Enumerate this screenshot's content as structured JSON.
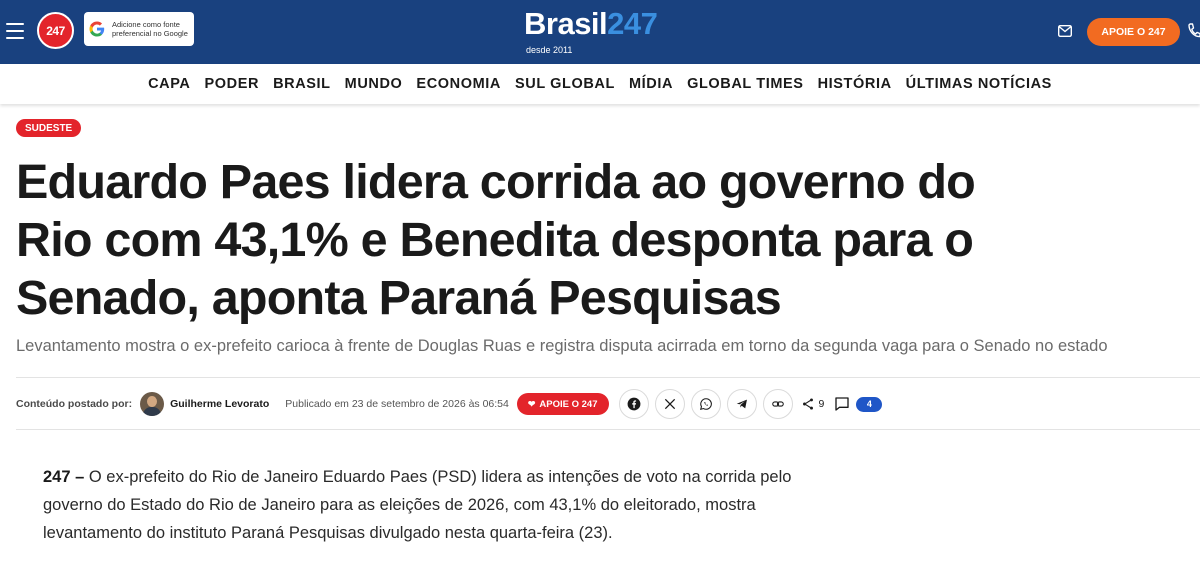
{
  "header": {
    "logo_badge": "247",
    "google_card_text": "Adicione como fonte preferencial no Google",
    "brand_word": "Brasil",
    "brand_num": "247",
    "brand_since": "desde 2011",
    "apoie_label": "APOIE O 247"
  },
  "nav": {
    "items": [
      "CAPA",
      "PODER",
      "BRASIL",
      "MUNDO",
      "ECONOMIA",
      "SUL GLOBAL",
      "MÍDIA",
      "GLOBAL TIMES",
      "HISTÓRIA",
      "ÚLTIMAS NOTÍCIAS"
    ]
  },
  "article": {
    "tag": "SUDESTE",
    "headline": "Eduardo Paes lidera corrida ao governo do Rio com 43,1% e Benedita desponta para o Senado, aponta Paraná Pesquisas",
    "subtitle": "Levantamento mostra o ex-prefeito carioca à frente de Douglas Ruas e registra disputa acirrada em torno da segunda vaga para o Senado no estado",
    "byline_label": "Conteúdo postado por:",
    "author": "Guilherme Levorato",
    "published": "Publicado em 23 de setembro de 2026 às 06:54",
    "apoie_inline": "APOIE O 247",
    "share_count": "9",
    "comment_count": "4",
    "body_lead": "247 –",
    "body_text": "O ex-prefeito do Rio de Janeiro Eduardo Paes (PSD) lidera as intenções de voto na corrida pelo governo do Estado do Rio de Janeiro para as eleições de 2026, com 43,1% do eleitorado, mostra levantamento do instituto Paraná Pesquisas divulgado nesta quarta-feira (23)."
  },
  "icons": {
    "share_buttons": [
      "facebook-icon",
      "x-icon",
      "whatsapp-icon",
      "telegram-icon",
      "link-icon"
    ]
  },
  "colors": {
    "header_bg": "#19417f",
    "accent_red": "#e3242b",
    "apoie_orange": "#f26b21",
    "brand_blue": "#3a8fe0",
    "badge_blue": "#1f56c7"
  }
}
